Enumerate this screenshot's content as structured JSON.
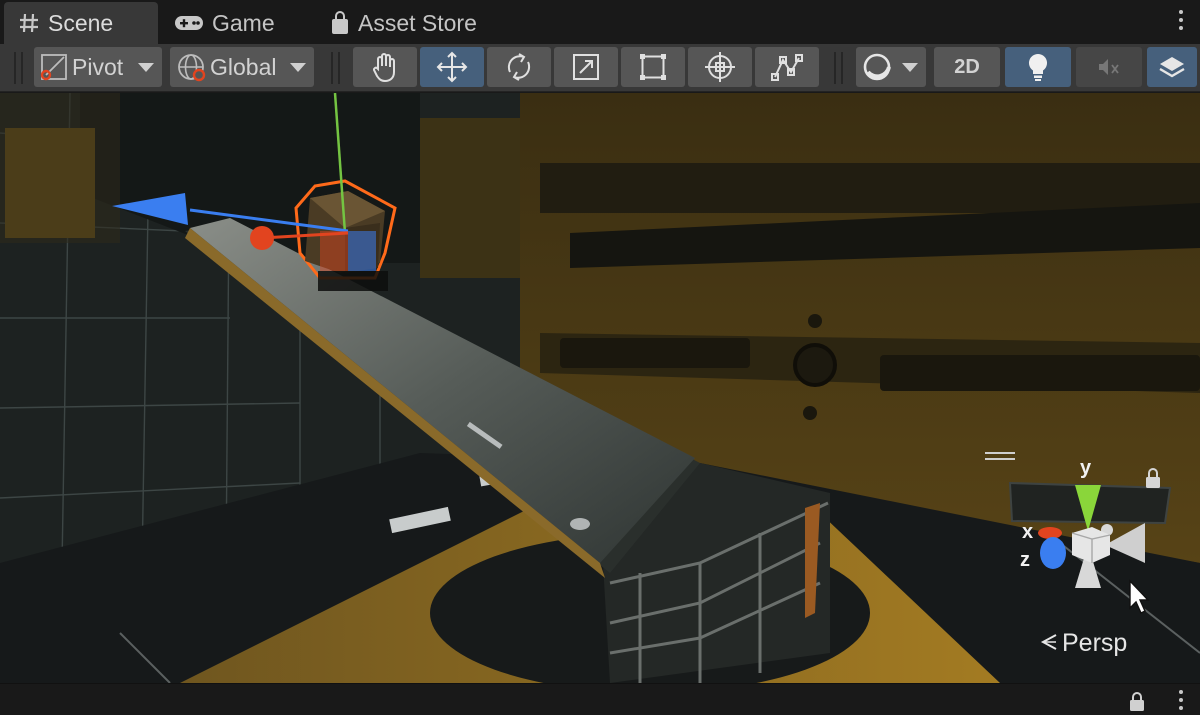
{
  "tabs": [
    {
      "label": "Scene",
      "icon": "grid-hash-icon",
      "active": true
    },
    {
      "label": "Game",
      "icon": "gamepad-icon",
      "active": false
    },
    {
      "label": "Asset Store",
      "icon": "shopping-bag-icon",
      "active": false
    }
  ],
  "toolbar": {
    "pivot_label": "Pivot",
    "global_label": "Global",
    "tools": [
      "hand-tool-icon",
      "move-tool-icon",
      "rotate-tool-icon",
      "scale-tool-icon",
      "rect-tool-icon",
      "transform-tool-icon",
      "custom-editor-tool-icon"
    ],
    "selected_tool": "move-tool-icon",
    "two_d_label": "2D",
    "lighting_enabled": true,
    "audio_enabled": false,
    "effects_enabled": true,
    "accent_color": "#46607c"
  },
  "gizmo": {
    "x_label": "x",
    "y_label": "y",
    "z_label": "z",
    "projection_label": "Persp",
    "x_color": "#e2441f",
    "y_color": "#8ad63a",
    "z_color": "#3a7ef0"
  }
}
